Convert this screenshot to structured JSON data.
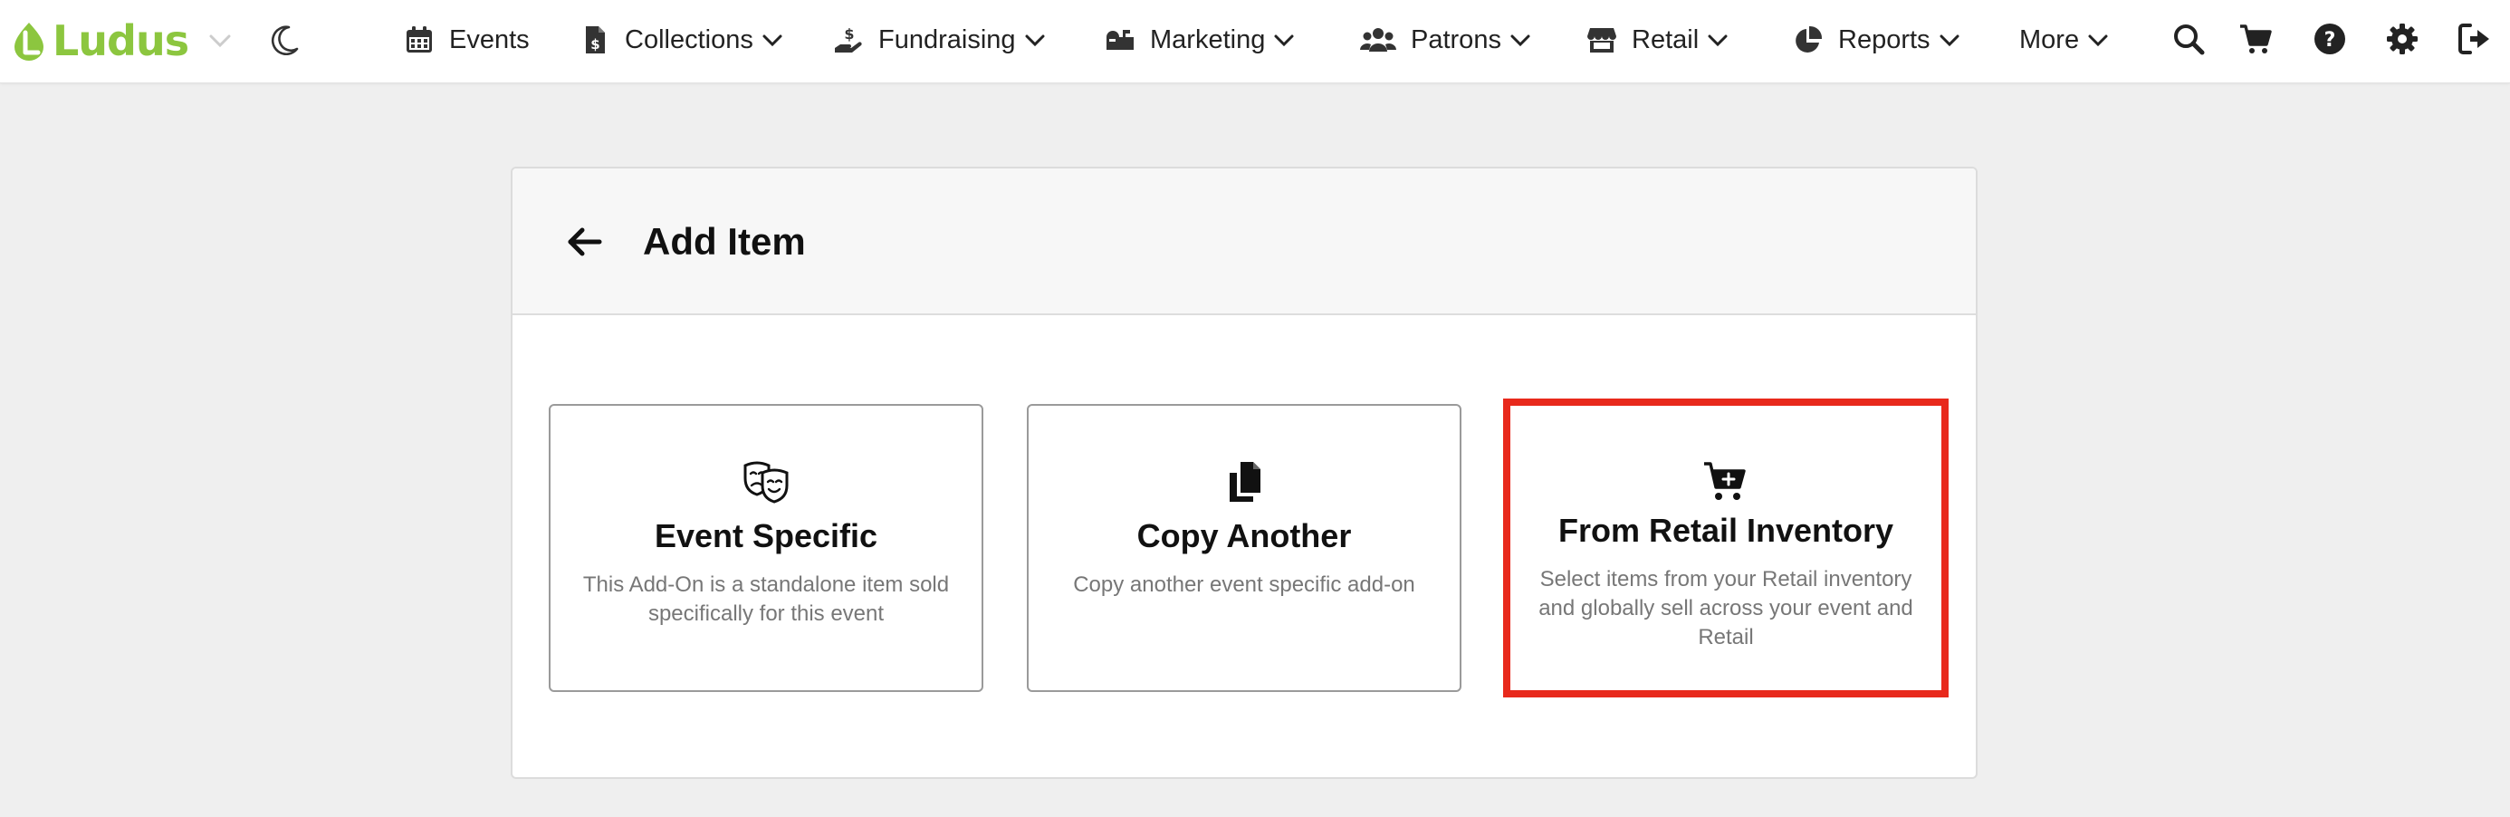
{
  "brand": {
    "name": "Ludus",
    "color": "#8cc63f"
  },
  "nav": {
    "items": [
      {
        "label": "Events",
        "icon": "calendar-icon",
        "has_dropdown": false
      },
      {
        "label": "Collections",
        "icon": "file-invoice-dollar-icon",
        "has_dropdown": true
      },
      {
        "label": "Fundraising",
        "icon": "hand-holding-dollar-icon",
        "has_dropdown": true
      },
      {
        "label": "Marketing",
        "icon": "mailbox-icon",
        "has_dropdown": true
      },
      {
        "label": "Patrons",
        "icon": "users-icon",
        "has_dropdown": true
      },
      {
        "label": "Retail",
        "icon": "store-icon",
        "has_dropdown": true
      },
      {
        "label": "Reports",
        "icon": "chart-pie-icon",
        "has_dropdown": true
      },
      {
        "label": "More",
        "icon": "",
        "has_dropdown": true
      }
    ],
    "utility_icons": [
      "search-icon",
      "cart-icon",
      "help-icon",
      "gear-icon",
      "sign-out-icon"
    ]
  },
  "page": {
    "title": "Add Item",
    "cards": [
      {
        "title": "Event Specific",
        "description": "This Add-On is a standalone item sold specifically for this event",
        "icon": "theater-masks-icon",
        "selected": false
      },
      {
        "title": "Copy Another",
        "description": "Copy another event specific add-on",
        "icon": "copy-icon",
        "selected": false
      },
      {
        "title": "From Retail Inventory",
        "description": "Select items from your Retail inventory and globally sell across your event and Retail",
        "icon": "cart-plus-icon",
        "selected": true
      }
    ]
  },
  "colors": {
    "selected_border": "#e8291c",
    "page_bg": "#efefef",
    "header_bg": "#f7f7f7",
    "desc_text": "#777777"
  }
}
